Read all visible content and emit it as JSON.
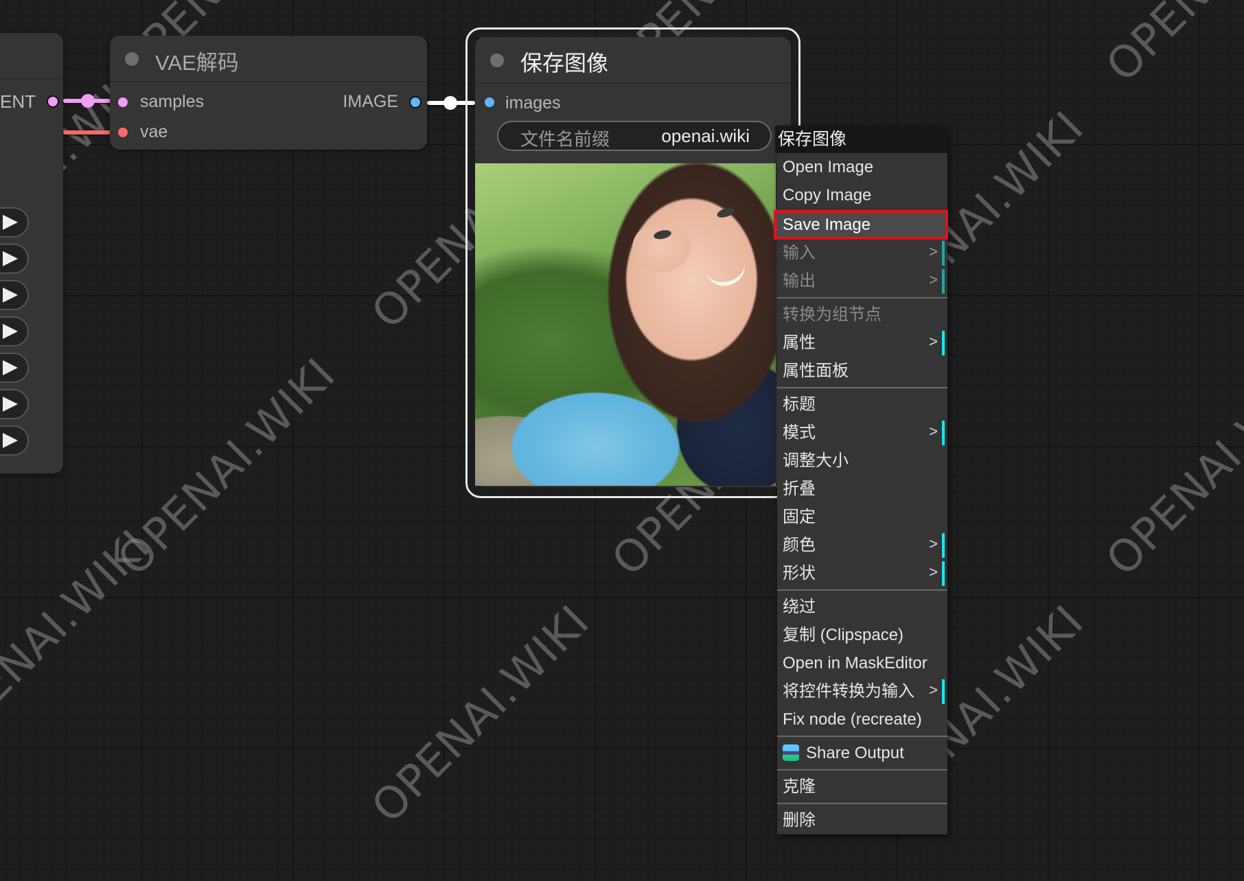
{
  "canvas": {
    "left_node": {
      "output_label": "ENT",
      "play_buttons_count": 7,
      "output_color": "#f39cf5"
    },
    "links": {
      "latent_color": "#f39cf5",
      "vae_color": "#f26b6b",
      "image_color": "#ffffff"
    },
    "vae_decode_node": {
      "title": "VAE解码",
      "inputs": [
        {
          "label": "samples",
          "color": "#f39cf5"
        },
        {
          "label": "vae",
          "color": "#f26b6b"
        }
      ],
      "outputs": [
        {
          "label": "IMAGE",
          "color": "#64b5f6"
        }
      ]
    },
    "save_image_node": {
      "title": "保存图像",
      "inputs": [
        {
          "label": "images",
          "color": "#64b5f6"
        }
      ],
      "widget": {
        "label": "文件名前缀",
        "value": "openai.wiki"
      },
      "preview_alt": "generated portrait preview"
    }
  },
  "context_menu": {
    "title": "保存图像",
    "items": [
      {
        "label": "Open Image"
      },
      {
        "label": "Copy Image"
      },
      {
        "label": "Save Image",
        "highlighted": true
      },
      {
        "label": "输入",
        "disabled": true,
        "submenu": true
      },
      {
        "label": "输出",
        "disabled": true,
        "submenu": true
      },
      {
        "separator": true
      },
      {
        "label": "转换为组节点",
        "disabled": true
      },
      {
        "label": "属性",
        "submenu": true
      },
      {
        "label": "属性面板"
      },
      {
        "separator": true
      },
      {
        "label": "标题"
      },
      {
        "label": "模式",
        "submenu": true
      },
      {
        "label": "调整大小"
      },
      {
        "label": "折叠"
      },
      {
        "label": "固定"
      },
      {
        "label": "颜色",
        "submenu": true
      },
      {
        "label": "形状",
        "submenu": true
      },
      {
        "separator": true
      },
      {
        "label": "绕过"
      },
      {
        "label": "复制 (Clipspace)"
      },
      {
        "label": "Open in MaskEditor"
      },
      {
        "label": "将控件转换为输入",
        "submenu": true
      },
      {
        "label": "Fix node (recreate)"
      },
      {
        "separator": true
      },
      {
        "label": "Share Output",
        "icon": "share-output-icon"
      },
      {
        "separator": true
      },
      {
        "label": "克隆"
      },
      {
        "separator": true
      },
      {
        "label": "删除"
      }
    ],
    "submenu_arrow": ">",
    "highlight_border_color": "#e1111b",
    "submenu_bar_color": "#17e6ef"
  },
  "watermark": {
    "text": "OPENAI.WIKI"
  }
}
